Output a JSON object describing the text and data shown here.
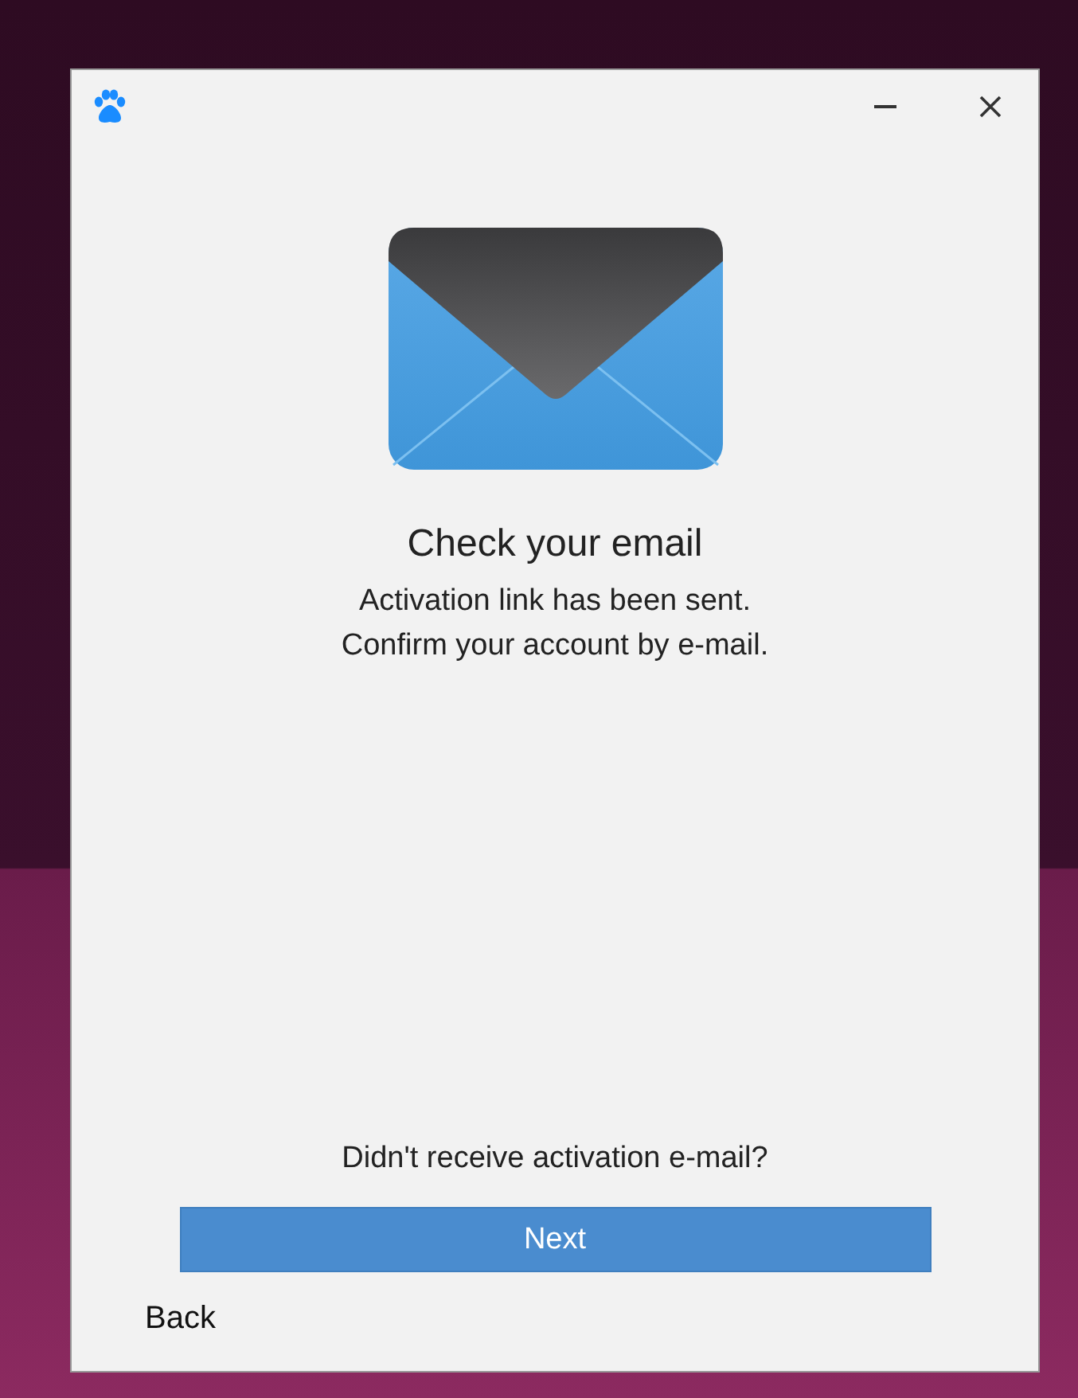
{
  "heading": "Check your email",
  "message_lines": [
    "Activation link has been sent.",
    "Confirm your account by e-mail."
  ],
  "resend_prompt": "Didn't receive activation e-mail?",
  "primary_button": {
    "label": "Next"
  },
  "secondary_button": {
    "label": "Back"
  }
}
